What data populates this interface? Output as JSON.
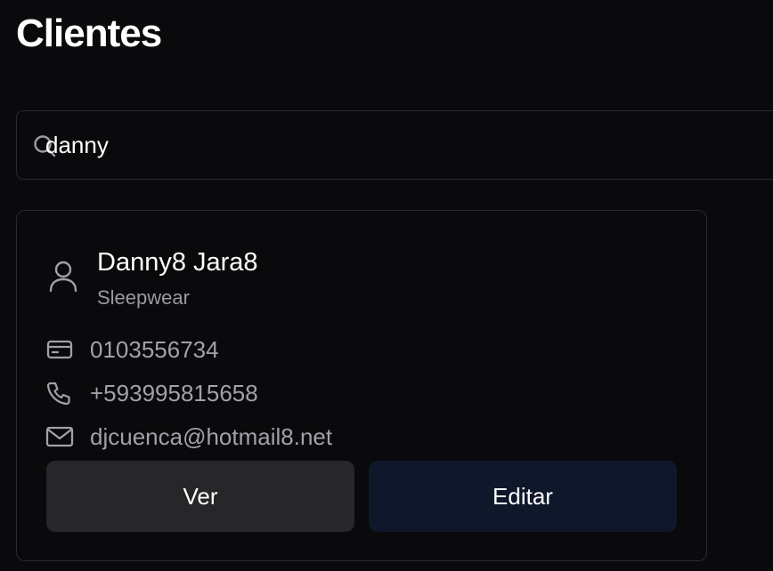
{
  "header": {
    "title": "Clientes"
  },
  "search": {
    "value": "danny",
    "placeholder": "",
    "icon": "search-icon"
  },
  "clients": [
    {
      "name": "Danny8 Jara8",
      "category": "Sleepwear",
      "id_number": "0103556734",
      "phone": "+593995815658",
      "email": "djcuenca@hotmail8.net",
      "actions": {
        "view_label": "Ver",
        "edit_label": "Editar"
      }
    }
  ],
  "icons": {
    "avatar": "user-icon",
    "id": "id-card-icon",
    "phone": "phone-icon",
    "email": "mail-icon"
  },
  "colors": {
    "background": "#0a0a0c",
    "border": "#2a2a2e",
    "muted_text": "#a1a1a8",
    "view_button": "#27272a",
    "edit_button": "#0f172a"
  }
}
